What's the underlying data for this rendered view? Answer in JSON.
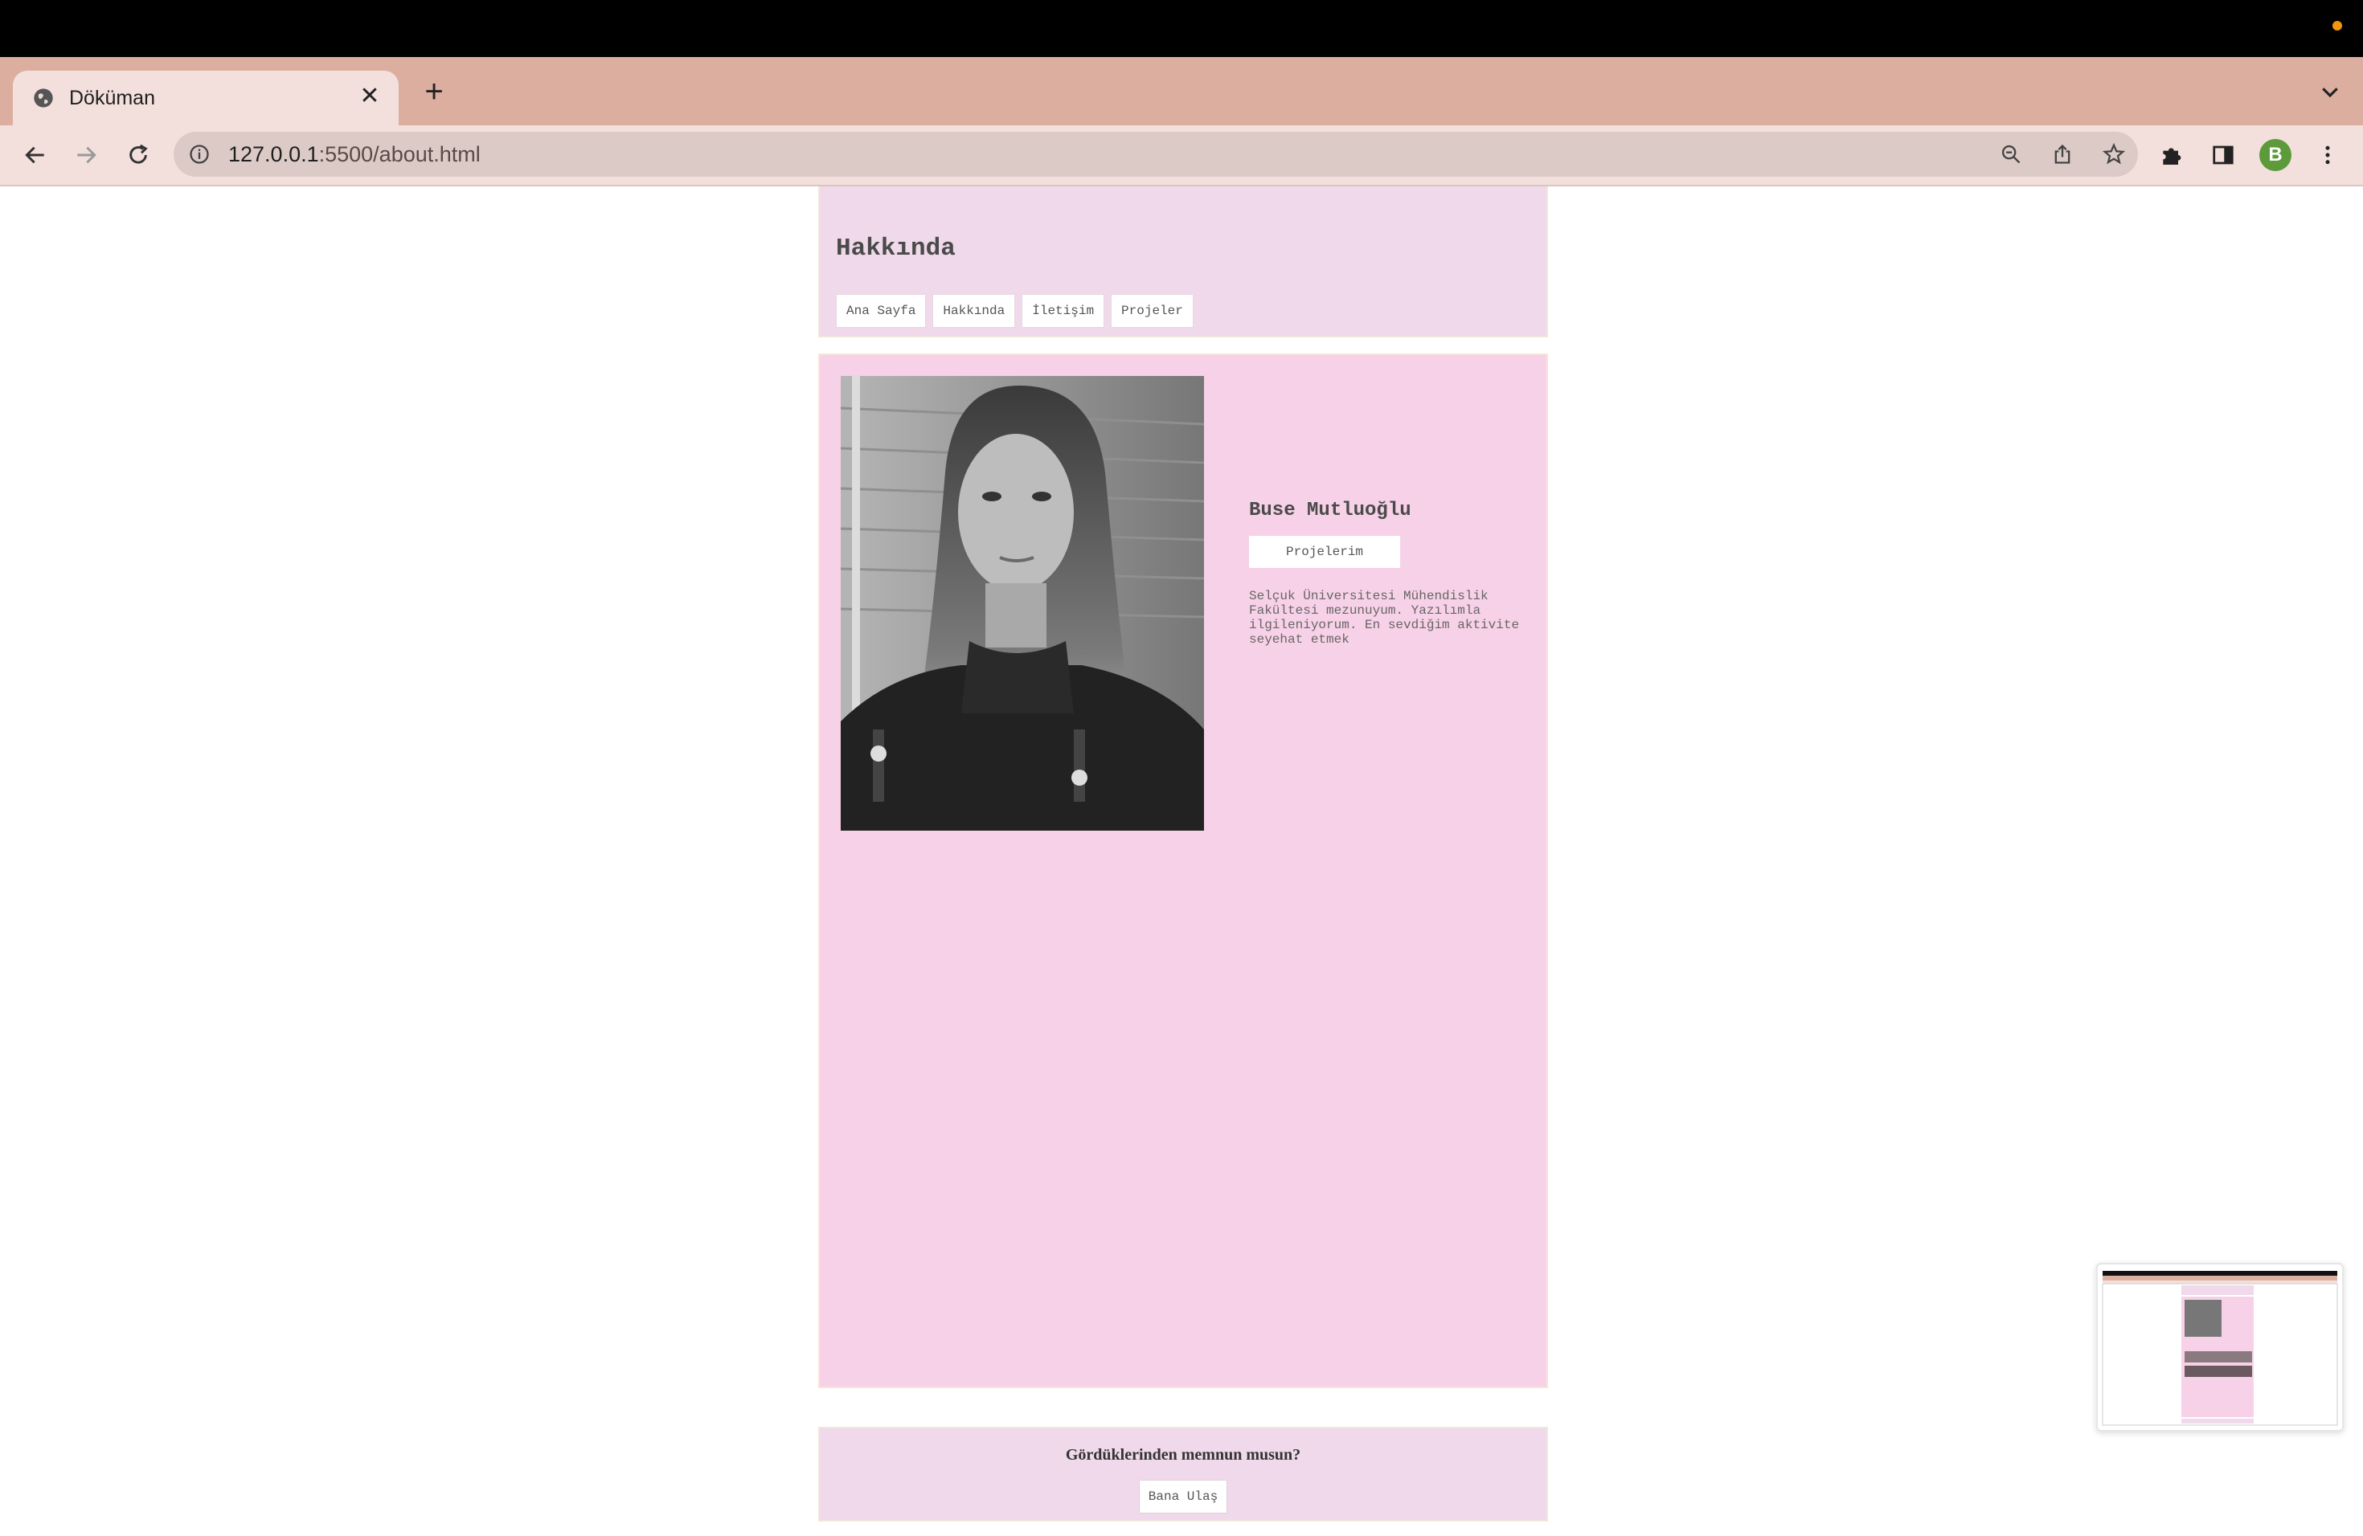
{
  "browser": {
    "tab_title": "Döküman",
    "url_host": "127.0.0.1",
    "url_path": ":5500/about.html",
    "profile_initial": "B"
  },
  "page": {
    "title": "Hakkında",
    "nav": [
      "Ana Sayfa",
      "Hakkında",
      "İletişim",
      "Projeler"
    ],
    "profile_name": "Buse Mutluoğlu",
    "projects_button": "Projelerim",
    "bio": "Selçuk Üniversitesi Mühendislik Fakültesi mezunuyum. Yazılımla ilgileniyorum. En sevdiğim aktivite seyehat etmek",
    "footer_question": "Gördüklerinden memnun musun?",
    "contact_button": "Bana Ulaş"
  },
  "colors": {
    "tabstrip": "#dcaea0",
    "toolbar": "#f3e0dc",
    "header_bg": "#efd9ea",
    "content_bg": "#f7d1e7"
  }
}
